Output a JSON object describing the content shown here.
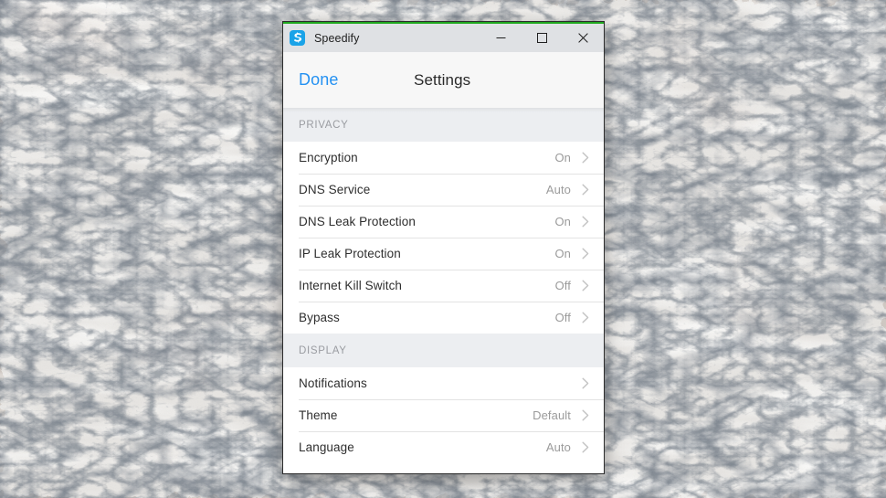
{
  "desktop": {
    "wallpaper_description": "marble-stone-texture-wallpaper",
    "base_color": "#cfc8c2"
  },
  "window": {
    "accent_color": "#1fa81f",
    "titlebar": {
      "app_icon_name": "speedify-app-icon",
      "app_icon_color": "#1aa3e8",
      "title": "Speedify",
      "controls": [
        {
          "name": "minimize-button",
          "icon": "minimize-icon"
        },
        {
          "name": "maximize-button",
          "icon": "maximize-icon"
        },
        {
          "name": "close-button",
          "icon": "close-icon"
        }
      ]
    },
    "navbar": {
      "done_label": "Done",
      "done_color": "#2491f2",
      "title": "Settings"
    },
    "sections": [
      {
        "header": "PRIVACY",
        "rows": [
          {
            "label": "Encryption",
            "value": "On",
            "chevron": "chevron-right-icon"
          },
          {
            "label": "DNS Service",
            "value": "Auto",
            "chevron": "chevron-right-icon"
          },
          {
            "label": "DNS Leak Protection",
            "value": "On",
            "chevron": "chevron-right-icon"
          },
          {
            "label": "IP Leak Protection",
            "value": "On",
            "chevron": "chevron-right-icon"
          },
          {
            "label": "Internet Kill Switch",
            "value": "Off",
            "chevron": "chevron-right-icon"
          },
          {
            "label": "Bypass",
            "value": "Off",
            "chevron": "chevron-right-icon"
          }
        ]
      },
      {
        "header": "DISPLAY",
        "rows": [
          {
            "label": "Notifications",
            "value": "",
            "chevron": "chevron-right-icon"
          },
          {
            "label": "Theme",
            "value": "Default",
            "chevron": "chevron-right-icon"
          },
          {
            "label": "Language",
            "value": "Auto",
            "chevron": "chevron-right-icon"
          }
        ]
      }
    ]
  }
}
